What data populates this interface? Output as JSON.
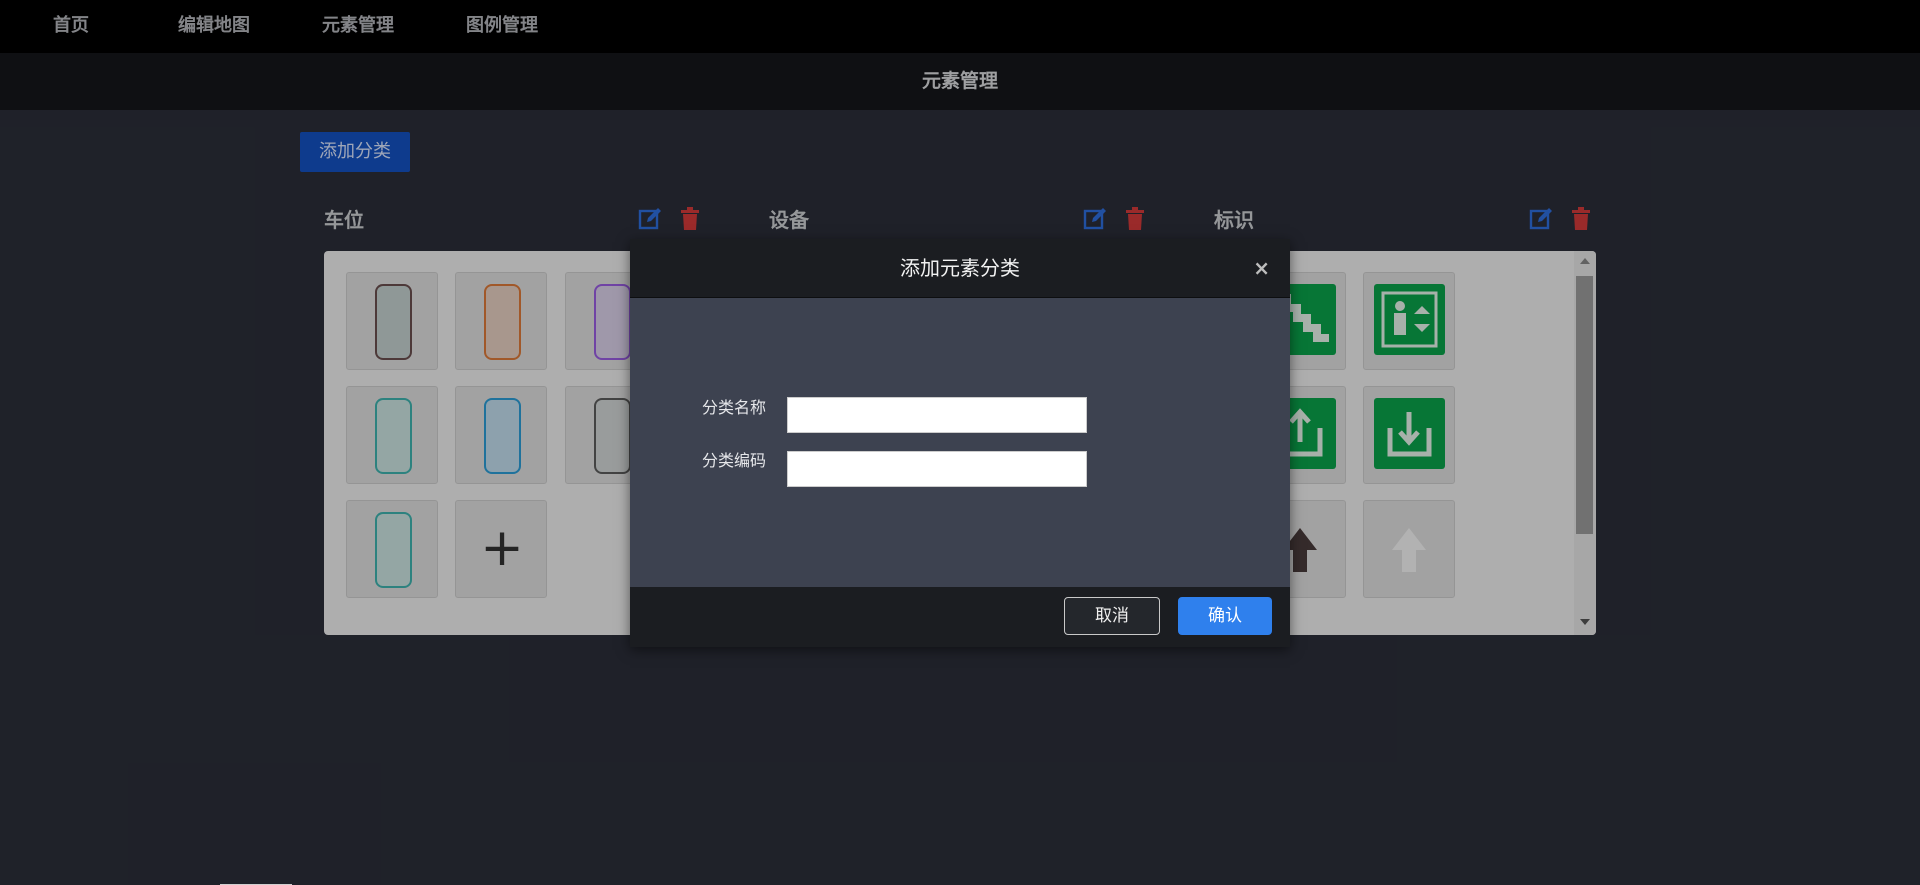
{
  "nav": {
    "items": [
      {
        "label": "首页"
      },
      {
        "label": "编辑地图"
      },
      {
        "label": "元素管理"
      },
      {
        "label": "图例管理"
      }
    ]
  },
  "page_title": "元素管理",
  "add_category_button": "添加分类",
  "categories": [
    {
      "name": "车位",
      "edit_icon": "edit-icon",
      "delete_icon": "trash-icon"
    },
    {
      "name": "设备",
      "edit_icon": "edit-icon",
      "delete_icon": "trash-icon"
    },
    {
      "name": "标识",
      "edit_icon": "edit-icon",
      "delete_icon": "trash-icon"
    }
  ],
  "parking_slot_colors": [
    "#6b4f4f",
    "#e07b39",
    "#9b5de5",
    "#3fb5b0",
    "#2b9ed8",
    "#5e5e5e",
    "#3fb5b0"
  ],
  "sign_items": [
    "escalator-sign",
    "stairs-sign",
    "elevator-sign",
    "avatar-image",
    "exit-up-sign",
    "exit-down-sign",
    "restroom-sign",
    "arrow-up-dark",
    "arrow-up-light"
  ],
  "colors": {
    "accent_blue": "#2f80ed",
    "sign_green": "#0aa44b",
    "danger_red": "#d63b3b",
    "edit_blue": "#2f6fe0"
  },
  "dialog": {
    "title": "添加元素分类",
    "close_icon": "close-icon",
    "fields": [
      {
        "label": "分类名称",
        "value": "",
        "placeholder": ""
      },
      {
        "label": "分类编码",
        "value": "",
        "placeholder": ""
      }
    ],
    "cancel_label": "取消",
    "confirm_label": "确认"
  }
}
